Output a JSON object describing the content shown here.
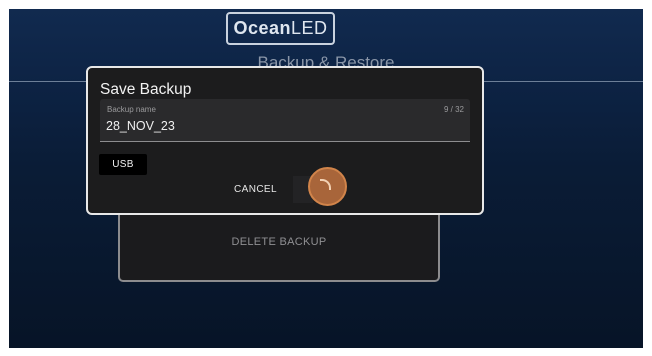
{
  "header": {
    "logo_bold": "Ocean",
    "logo_rest": "LED",
    "title": "Backup & Restore"
  },
  "panel": {
    "delete_label": "DELETE BACKUP"
  },
  "dialog": {
    "title": "Save Backup",
    "field_label": "Backup name",
    "field_value": "28_NOV_23",
    "char_count": "9 / 32",
    "usb_label": "USB",
    "cancel_label": "CANCEL"
  },
  "colors": {
    "background": "#0d2344",
    "dialog_bg": "#1c1c1d",
    "touch_indicator": "#a8653a"
  }
}
